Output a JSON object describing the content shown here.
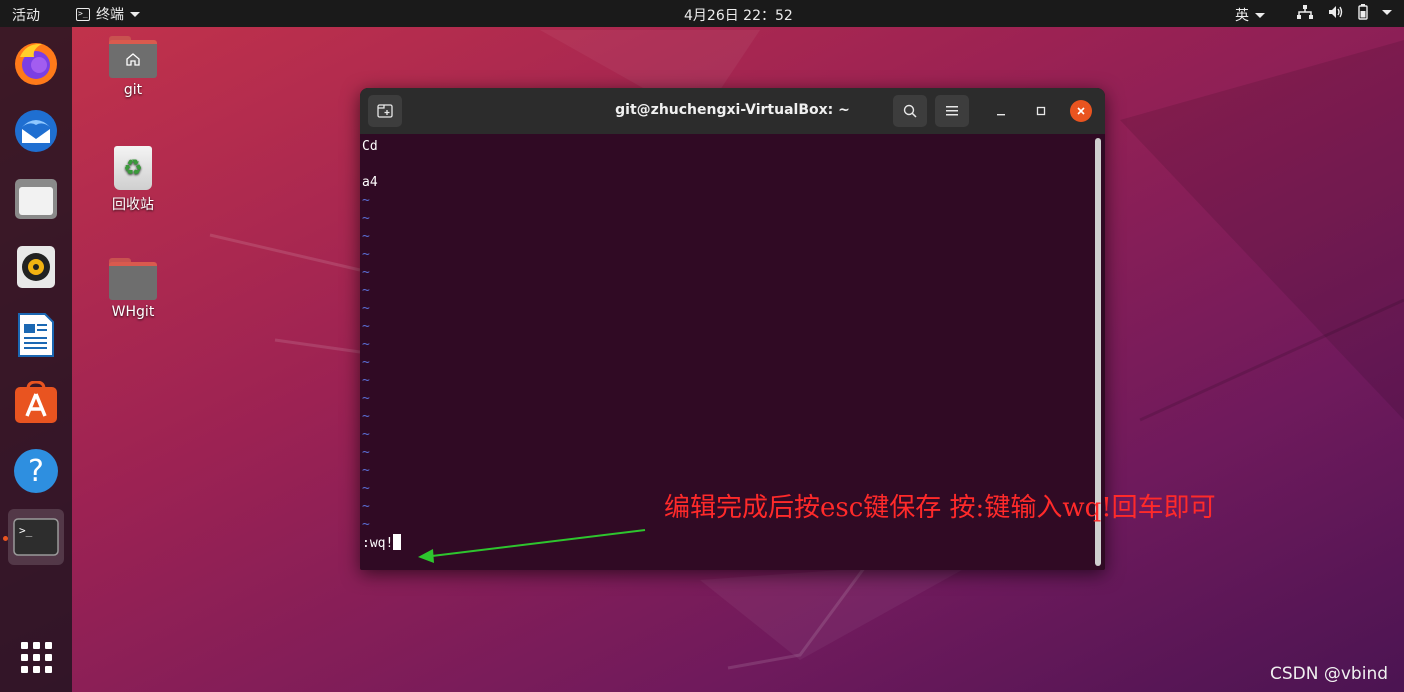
{
  "topbar": {
    "activities": "活动",
    "app_name": "终端",
    "clock": "4月26日  22：52",
    "input_method": "英"
  },
  "dock": {
    "items": [
      "firefox-icon",
      "thunderbird-icon",
      "files-icon",
      "rhythmbox-icon",
      "libreoffice-writer-icon",
      "software-center-icon",
      "help-icon",
      "terminal-icon",
      "show-apps-icon"
    ]
  },
  "desktop": {
    "icons": [
      {
        "label": "git",
        "icon": "home-folder-icon"
      },
      {
        "label": "回收站",
        "icon": "trash-icon"
      },
      {
        "label": "WHgit",
        "icon": "folder-icon"
      }
    ]
  },
  "terminal": {
    "title": "git@zhuchengxi-VirtualBox: ~",
    "lines": [
      "Cd",
      "",
      "a4"
    ],
    "tilde": "~",
    "tilde_count": 19,
    "command_line": ":wq!"
  },
  "annotation": {
    "text": "编辑完成后按esc键保存 按:键输入wq!回车即可",
    "color": "#ff2a2a",
    "arrow_color": "#2ec52e"
  },
  "watermark": "CSDN @vbind"
}
